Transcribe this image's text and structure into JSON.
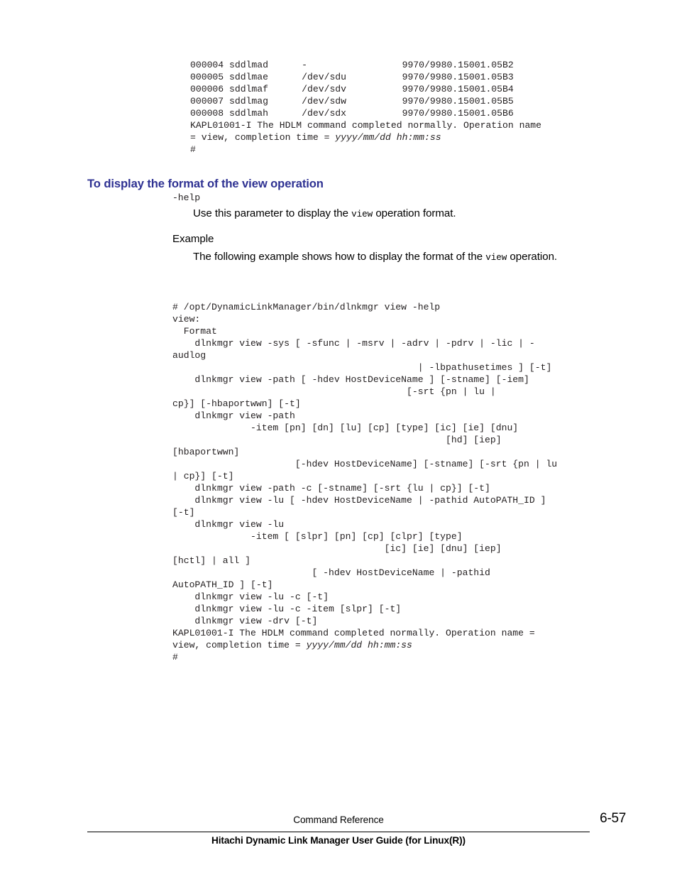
{
  "document": {
    "product": "Hitachi Dynamic Link Manager",
    "page_number": "6-57",
    "running_head": "Command Reference",
    "guide_title": "Hitachi Dynamic Link Manager User Guide (for Linux(R))",
    "heading_color": "#2e3192"
  },
  "top_output": {
    "name": "dlnkmgr-view-output-continuation",
    "lines": [
      "000004 sddlmad      -                 9970/9980.15001.05B2",
      "000005 sddlmae      /dev/sdu          9970/9980.15001.05B3",
      "000006 sddlmaf      /dev/sdv          9970/9980.15001.05B4",
      "000007 sddlmag      /dev/sdw          9970/9980.15001.05B5",
      "000008 sddlmah      /dev/sdx          9970/9980.15001.05B6",
      "KAPL01001-I The HDLM command completed normally. Operation name",
      "= view, completion time = yyyy/mm/dd hh:mm:ss",
      "#"
    ],
    "italic_segments": [
      "yyyy/mm/dd hh:mm:ss"
    ]
  },
  "section": {
    "heading": "To display the format of the view operation",
    "parameter": {
      "name": "-help",
      "description_before": "Use this parameter to display the ",
      "description_mono": "view",
      "description_after": " operation format."
    },
    "example": {
      "label": "Example",
      "text_before": "The following example shows how to display the format of the ",
      "text_mono": "view",
      "text_after": " operation."
    }
  },
  "format_output": {
    "name": "dlnkmgr-view-help-output",
    "lines": [
      "# /opt/DynamicLinkManager/bin/dlnkmgr view -help",
      "view:",
      "  Format",
      "    dlnkmgr view -sys [ -sfunc | -msrv | -adrv | -pdrv | -lic | -",
      "audlog",
      "                                            | -lbpathusetimes ] [-t]",
      "    dlnkmgr view -path [ -hdev HostDeviceName ] [-stname] [-iem]",
      "                                          [-srt {pn | lu |",
      "cp}] [-hbaportwwn] [-t]",
      "    dlnkmgr view -path",
      "              -item [pn] [dn] [lu] [cp] [type] [ic] [ie] [dnu]",
      "                                                 [hd] [iep]",
      "[hbaportwwn]",
      "                      [-hdev HostDeviceName] [-stname] [-srt {pn | lu",
      "| cp}] [-t]",
      "    dlnkmgr view -path -c [-stname] [-srt {lu | cp}] [-t]",
      "    dlnkmgr view -lu [ -hdev HostDeviceName | -pathid AutoPATH_ID ]",
      "[-t]",
      "    dlnkmgr view -lu",
      "              -item [ [slpr] [pn] [cp] [clpr] [type]",
      "                                      [ic] [ie] [dnu] [iep]",
      "[hctl] | all ]",
      "                         [ -hdev HostDeviceName | -pathid",
      "AutoPATH_ID ] [-t]",
      "    dlnkmgr view -lu -c [-t]",
      "    dlnkmgr view -lu -c -item [slpr] [-t]",
      "    dlnkmgr view -drv [-t]",
      "KAPL01001-I The HDLM command completed normally. Operation name =",
      "view, completion time = yyyy/mm/dd hh:mm:ss",
      "#"
    ],
    "italic_segments": [
      "yyyy/mm/dd hh:mm:ss"
    ]
  }
}
